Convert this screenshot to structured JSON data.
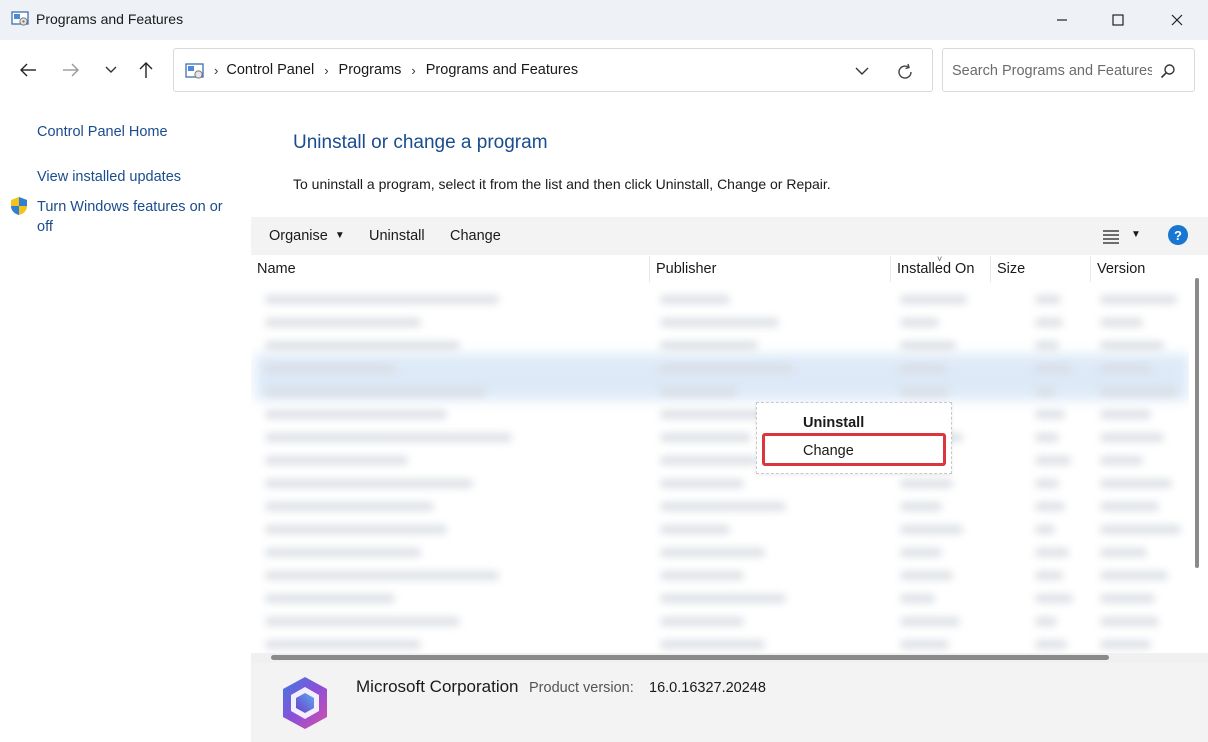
{
  "window": {
    "title": "Programs and Features",
    "controls": [
      "minimize-icon",
      "maximize-icon",
      "close-icon"
    ]
  },
  "address": {
    "breadcrumbs": [
      "Control Panel",
      "Programs",
      "Programs and Features"
    ]
  },
  "search": {
    "placeholder": "Search Programs and Features"
  },
  "left_nav": {
    "items": [
      {
        "label": "Control Panel Home"
      },
      {
        "label": "View installed updates"
      },
      {
        "label": "Turn Windows features on or off",
        "icon": "shield-icon"
      }
    ]
  },
  "main": {
    "title": "Uninstall or change a program",
    "description": "To uninstall a program, select it from the list and then click Uninstall, Change or Repair."
  },
  "toolbar": {
    "organise": "Organise",
    "uninstall": "Uninstall",
    "change": "Change",
    "help": "?"
  },
  "columns": [
    "Name",
    "Publisher",
    "Installed On",
    "Size",
    "Version"
  ],
  "context_menu": {
    "items": [
      "Uninstall",
      "Change"
    ],
    "highlighted": "Change"
  },
  "details": {
    "publisher": "Microsoft Corporation",
    "version_label": "Product version:",
    "version_value": "16.0.16327.20248"
  },
  "colors": {
    "link": "#1a4c8e",
    "highlight_border": "#d9363e",
    "help": "#1977d2"
  }
}
